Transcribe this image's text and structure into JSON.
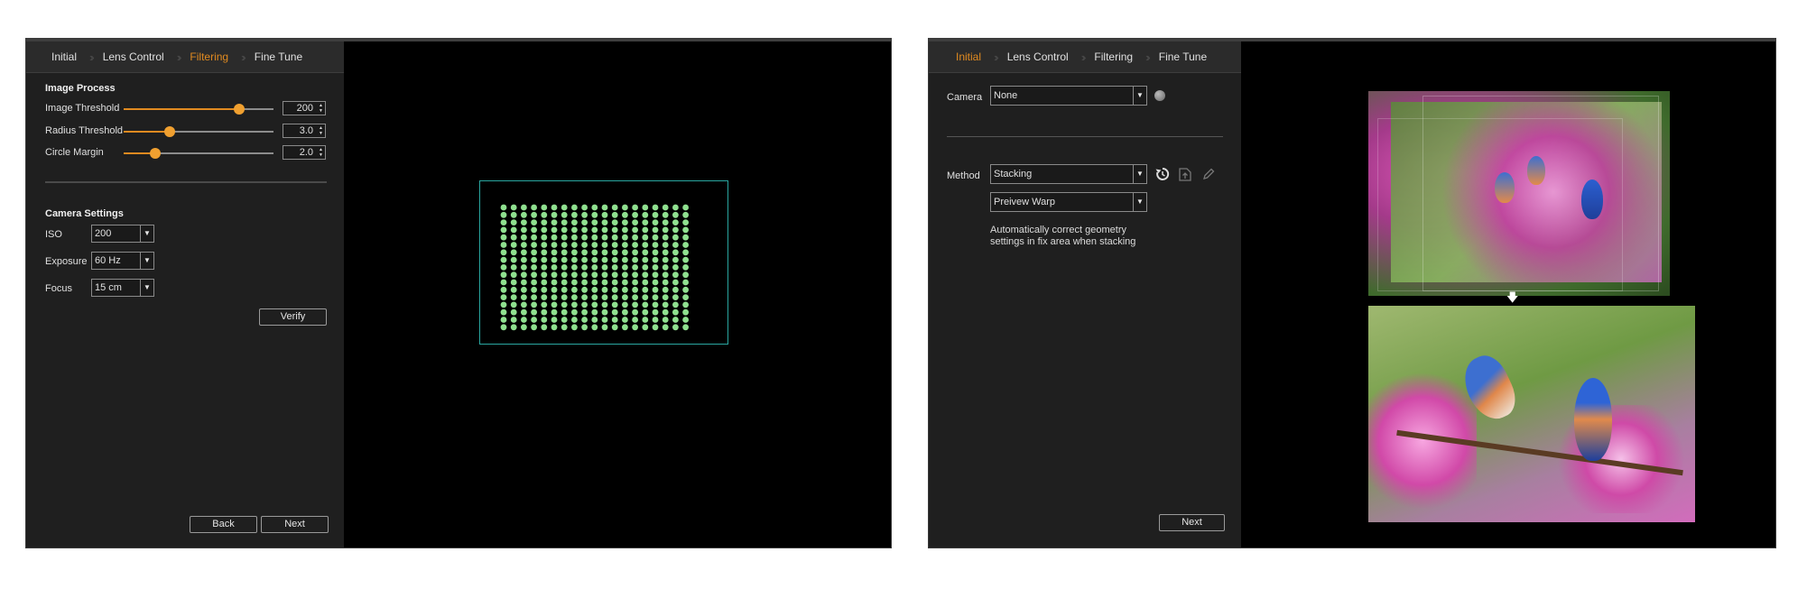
{
  "window1": {
    "tabs": [
      {
        "label": "Initial",
        "active": false
      },
      {
        "label": "Lens Control",
        "active": false
      },
      {
        "label": "Filtering",
        "active": true
      },
      {
        "label": "Fine Tune",
        "active": false
      }
    ],
    "image_process": {
      "title": "Image Process",
      "sliders": [
        {
          "label": "Image Threshold",
          "value": "200",
          "level": 0.77
        },
        {
          "label": "Radius Threshold",
          "value": "3.0",
          "level": 0.31
        },
        {
          "label": "Circle Margin",
          "value": "2.0",
          "level": 0.21
        }
      ]
    },
    "camera_settings": {
      "title": "Camera Settings",
      "fields": [
        {
          "label": "ISO",
          "value": "200"
        },
        {
          "label": "Exposure",
          "value": "60 Hz"
        },
        {
          "label": "Focus",
          "value": "15 cm"
        }
      ]
    },
    "verify_label": "Verify",
    "back_label": "Back",
    "next_label": "Next",
    "grid": {
      "rows": 17,
      "cols": 19,
      "dot_color": "#8fe08f",
      "frame_color": "#2aa6a0"
    }
  },
  "window2": {
    "tabs": [
      {
        "label": "Initial",
        "active": true
      },
      {
        "label": "Lens Control",
        "active": false
      },
      {
        "label": "Filtering",
        "active": false
      },
      {
        "label": "Fine Tune",
        "active": false
      }
    ],
    "camera_label": "Camera",
    "camera_value": "None",
    "method_label": "Method",
    "method_value": "Stacking",
    "warp_value": "Preivew Warp",
    "note_line1": "Automatically correct geometry",
    "note_line2": "settings in fix area when stacking",
    "next_label": "Next",
    "icons": [
      "reset-icon",
      "export-icon",
      "edit-icon",
      "status-indicator-icon",
      "down-arrow-icon"
    ]
  },
  "colors": {
    "accent": "#e08a20",
    "panel": "#1f1f1f",
    "tabbar": "#2b2b2b",
    "background": "#000000"
  }
}
